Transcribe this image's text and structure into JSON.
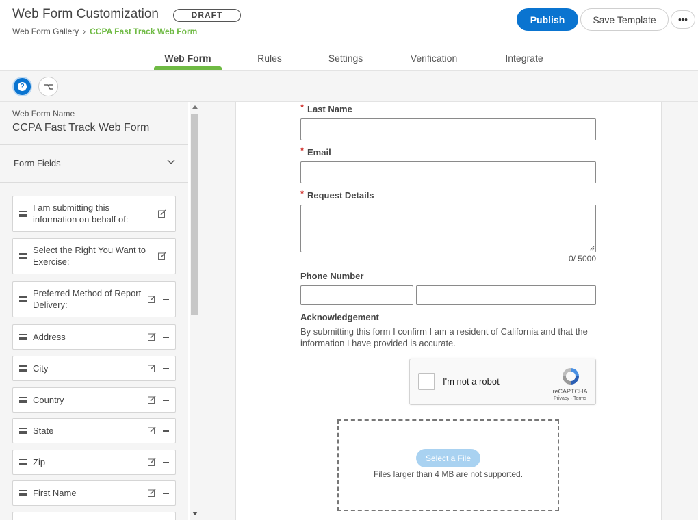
{
  "header": {
    "title": "Web Form Customization",
    "status_badge": "DRAFT",
    "breadcrumb_parent": "Web Form Gallery",
    "breadcrumb_sep": "›",
    "breadcrumb_current": "CCPA Fast Track Web Form",
    "publish_label": "Publish",
    "save_template_label": "Save Template",
    "more_label": "•••"
  },
  "tabs": [
    {
      "label": "Web Form",
      "active": true
    },
    {
      "label": "Rules",
      "active": false
    },
    {
      "label": "Settings",
      "active": false
    },
    {
      "label": "Verification",
      "active": false
    },
    {
      "label": "Integrate",
      "active": false
    }
  ],
  "toolbar": {
    "help_glyph": "?",
    "branch_glyph": "⌥"
  },
  "sidebar": {
    "name_label": "Web Form Name",
    "name_value": "CCPA Fast Track Web Form",
    "fields_header": "Form Fields",
    "fields": [
      {
        "label": "I am submitting this information on behalf of:",
        "removable": false
      },
      {
        "label": "Select the Right You Want to Exercise:",
        "removable": false
      },
      {
        "label": "Preferred Method of Report Delivery:",
        "removable": true
      },
      {
        "label": "Address",
        "removable": true
      },
      {
        "label": "City",
        "removable": true
      },
      {
        "label": "Country",
        "removable": true
      },
      {
        "label": "State",
        "removable": true
      },
      {
        "label": "Zip",
        "removable": true
      },
      {
        "label": "First Name",
        "removable": true
      }
    ]
  },
  "form": {
    "required_mark": "*",
    "last_name_label": "Last Name",
    "email_label": "Email",
    "request_details_label": "Request Details",
    "char_counter": "0/ 5000",
    "phone_label": "Phone Number",
    "ack_label": "Acknowledgement",
    "ack_text": "By submitting this form I confirm I am a resident of California and that the information I have provided is accurate.",
    "recaptcha_label": "I'm not a robot",
    "recaptcha_brand": "reCAPTCHA",
    "recaptcha_terms": "Privacy - Terms",
    "select_file_label": "Select a File",
    "file_note": "Files larger than 4 MB are not supported."
  },
  "colors": {
    "primary": "#0a74d0",
    "accent_green": "#6fba44",
    "required_red": "#d0312d",
    "select_file_disabled": "#a9d2f1"
  }
}
